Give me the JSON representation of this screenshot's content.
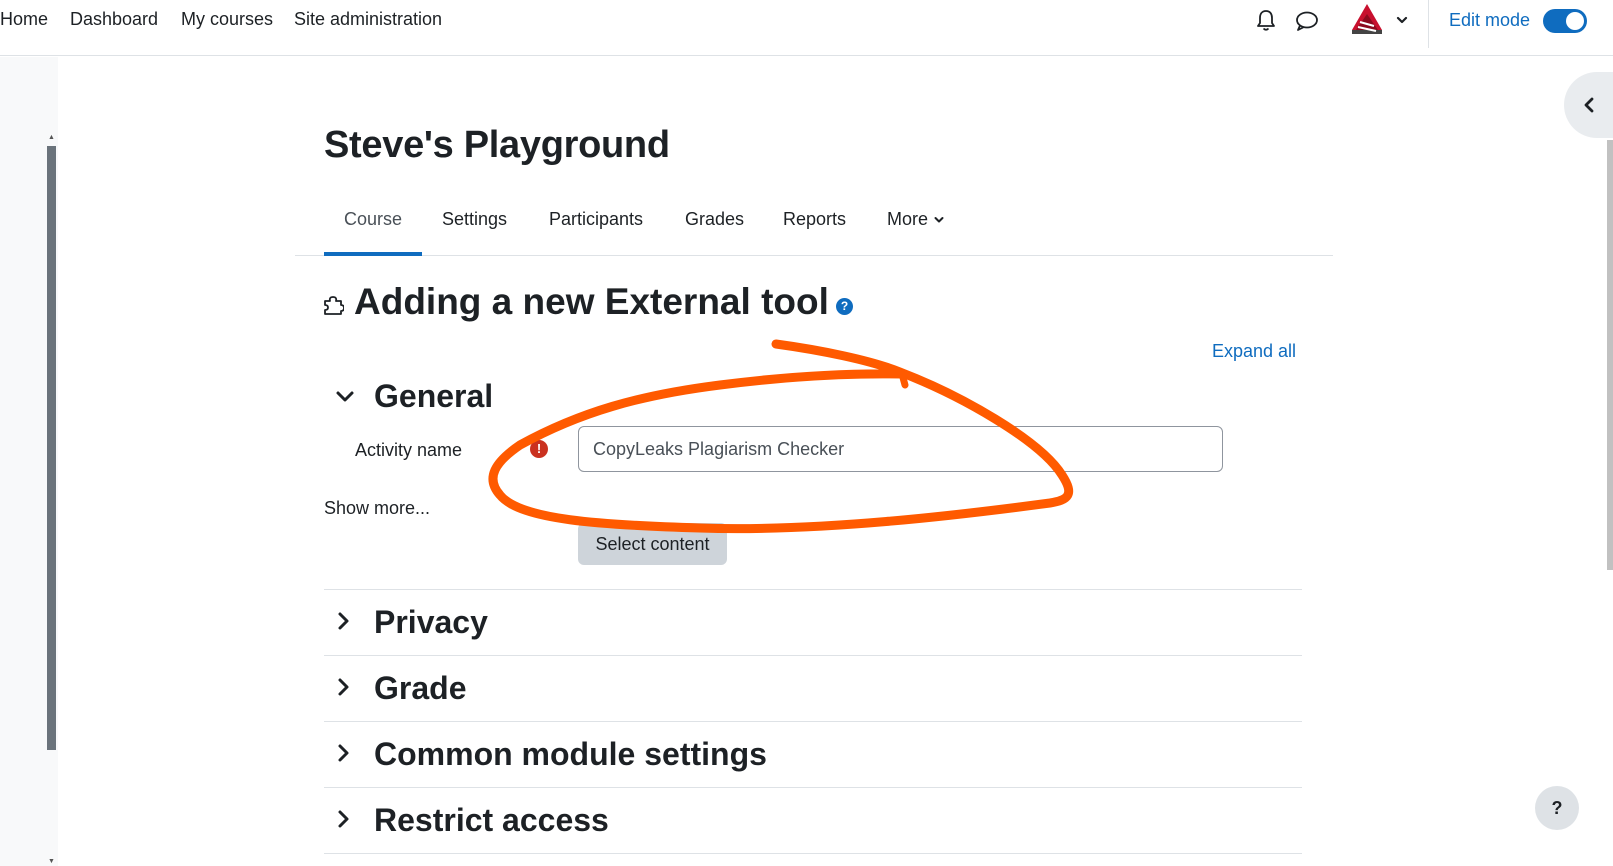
{
  "nav": {
    "links": [
      "Home",
      "Dashboard",
      "My courses",
      "Site administration"
    ],
    "edit_mode_label": "Edit mode",
    "edit_mode_on": true,
    "icons": [
      "bell-icon",
      "chat-icon",
      "avatar",
      "chevron-down-icon"
    ]
  },
  "course": {
    "title": "Steve's Playground"
  },
  "tabs": {
    "items": [
      "Course",
      "Settings",
      "Participants",
      "Grades",
      "Reports",
      "More"
    ],
    "active": "Course"
  },
  "page": {
    "heading": "Adding a new External tool",
    "help_glyph": "?",
    "expand_all": "Expand all"
  },
  "sections": {
    "general": "General",
    "privacy": "Privacy",
    "grade": "Grade",
    "common_module": "Common module settings",
    "restrict_access": "Restrict access"
  },
  "form": {
    "activity_name_label": "Activity name",
    "required_glyph": "!",
    "activity_name_value": "CopyLeaks Plagiarism Checker",
    "show_more": "Show more...",
    "select_content": "Select content"
  },
  "help_fab": "?",
  "colors": {
    "accent": "#0f6cbf",
    "annotation": "#ff5a00",
    "required": "#ca3120"
  }
}
